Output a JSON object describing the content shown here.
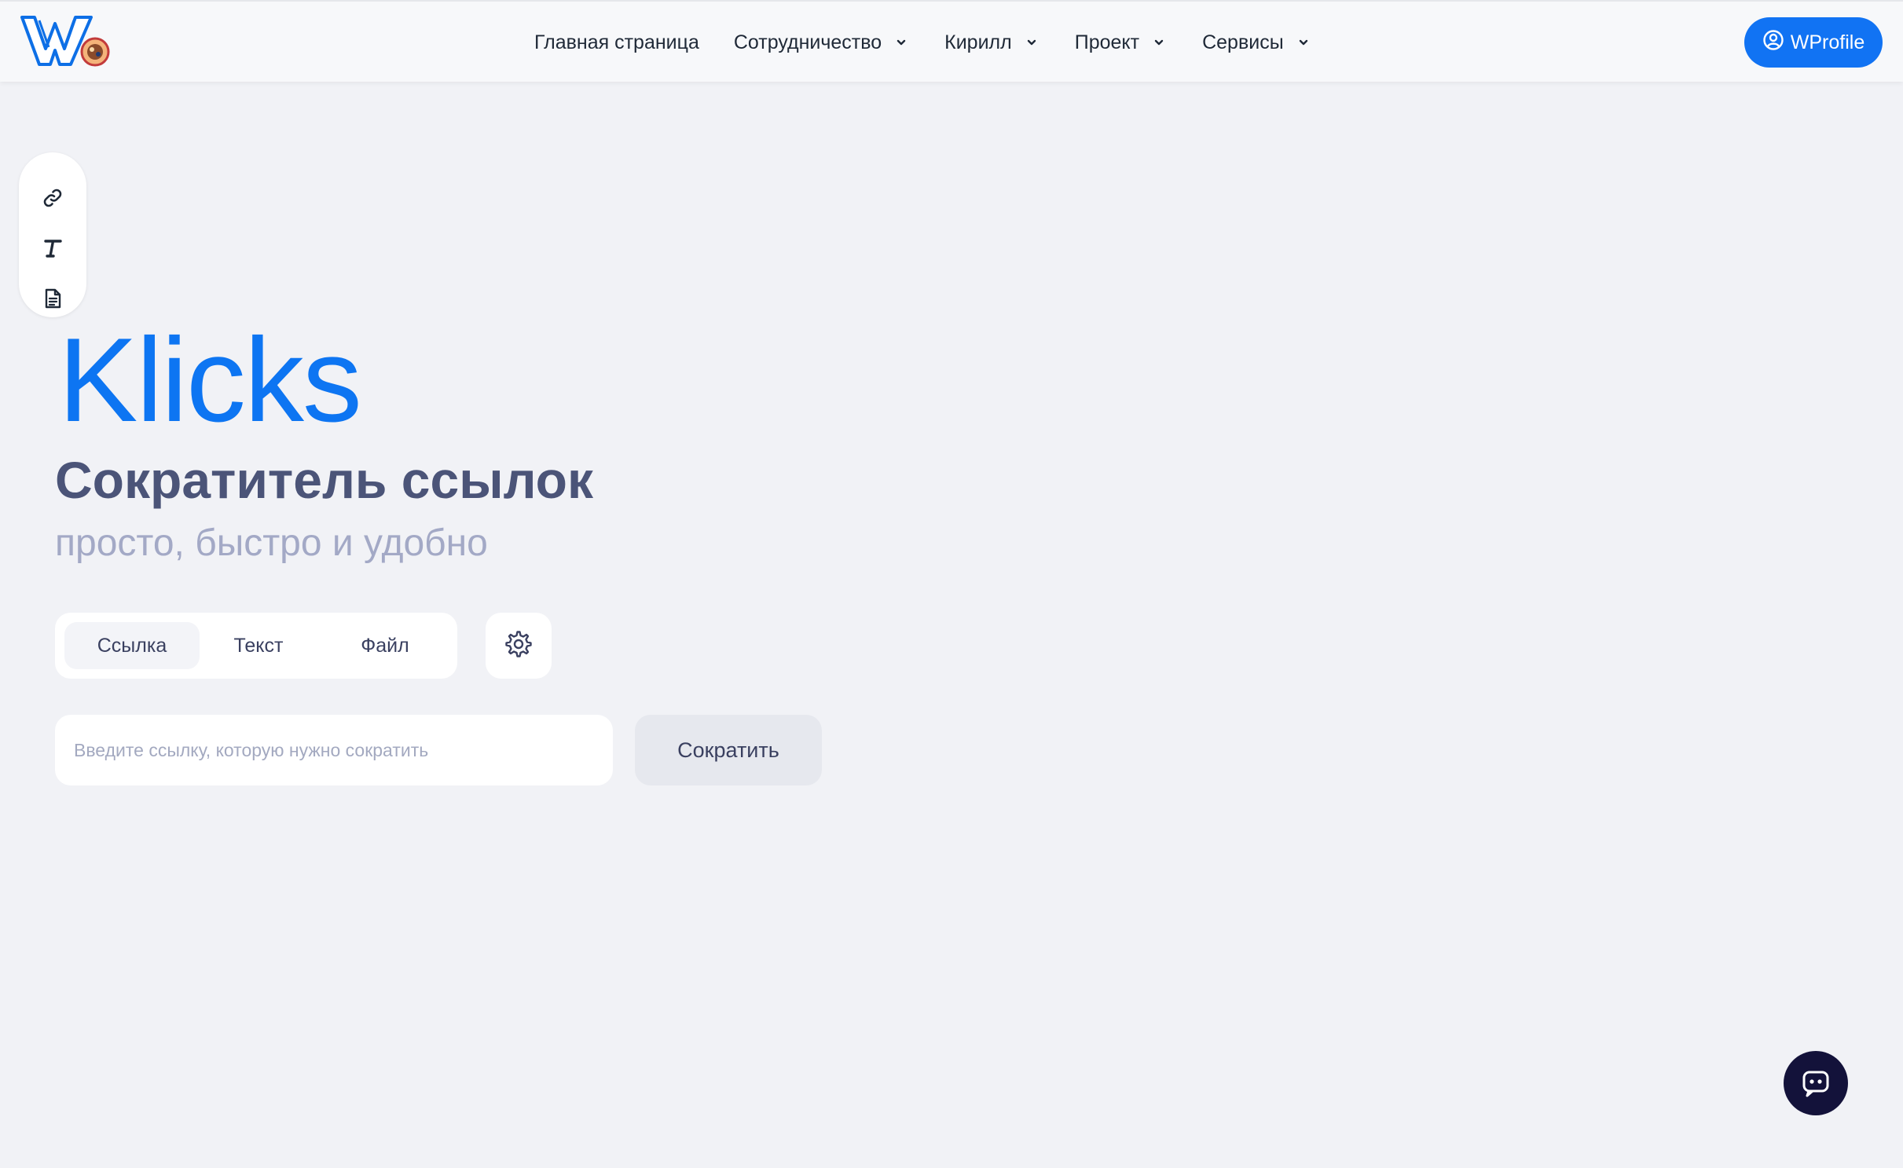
{
  "header": {
    "logo_icon": "wprofile-logo-icon",
    "nav": [
      {
        "label": "Главная страница",
        "has_dropdown": false
      },
      {
        "label": "Сотрудничество",
        "has_dropdown": true
      },
      {
        "label": "Кирилл",
        "has_dropdown": true
      },
      {
        "label": "Проект",
        "has_dropdown": true
      },
      {
        "label": "Сервисы",
        "has_dropdown": true
      }
    ],
    "profile_label": "WProfile",
    "profile_icon": "user-circle-icon"
  },
  "side_toolbar": {
    "items": [
      {
        "icon": "link-icon"
      },
      {
        "icon": "text-icon"
      },
      {
        "icon": "document-icon"
      }
    ]
  },
  "hero": {
    "brand": "Klicks",
    "subtitle": "Сократитель ссылок",
    "tagline": "просто, быстро и удобно"
  },
  "mode_tabs": {
    "items": [
      {
        "label": "Ссылка",
        "active": true
      },
      {
        "label": "Текст",
        "active": false
      },
      {
        "label": "Файл",
        "active": false
      }
    ],
    "settings_icon": "gear-icon"
  },
  "shortener": {
    "input_value": "",
    "input_placeholder": "Введите ссылку, которую нужно сократить",
    "submit_label": "Сократить"
  },
  "chat": {
    "icon": "chat-bot-icon"
  },
  "colors": {
    "accent": "#0d75f2",
    "background": "#f1f2f6",
    "subtitle": "#4b5478",
    "tagline": "#a3a9c6",
    "chat_button": "#13123a"
  }
}
